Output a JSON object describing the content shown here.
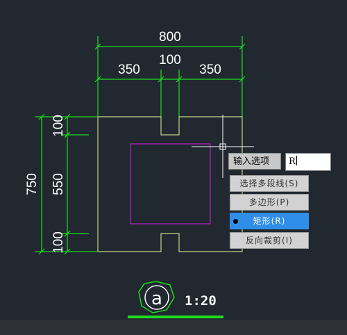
{
  "drawing": {
    "dimensions": {
      "total_width": "800",
      "left_width": "350",
      "middle_width": "100",
      "right_width": "350",
      "total_height": "750",
      "top_height": "100",
      "middle_height": "550",
      "bottom_height": "100"
    },
    "label_symbol": "a",
    "scale": "1:20"
  },
  "command": {
    "prompt_label": "输入选项",
    "input_value": "R"
  },
  "menu": {
    "items": [
      {
        "label": "选择多段线(S)"
      },
      {
        "label": "多边形(P)"
      },
      {
        "label": "矩形(R)"
      },
      {
        "label": "反向裁剪(I)"
      }
    ],
    "selected_index": 2
  },
  "colors": {
    "background": "#212830",
    "dimension_lines": "#1fdc1f",
    "outline": "#c8d28a",
    "clip_rectangle": "#c020c8",
    "label_ring": "#1fdc1f",
    "menu_highlight": "#2f8fe8"
  }
}
